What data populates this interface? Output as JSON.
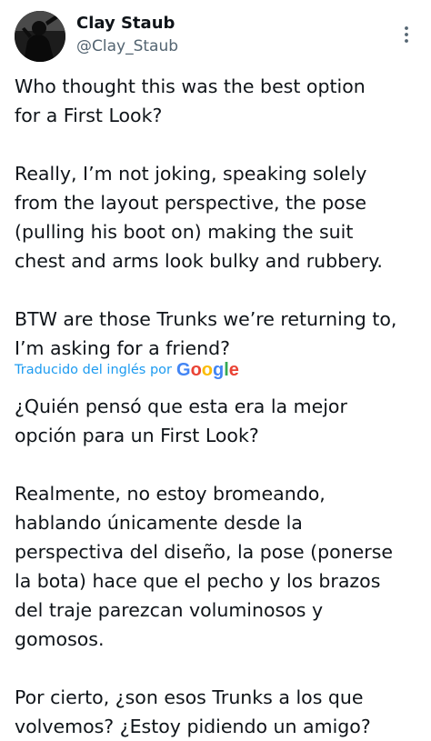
{
  "author": {
    "display_name": "Clay Staub",
    "handle": "@Clay_Staub",
    "avatar_icon": "profile-avatar"
  },
  "menu": {
    "icon": "more-vertical-icon"
  },
  "tweet": {
    "original_text": "Who thought this was the best option\nfor a First Look?\n\nReally, I’m not joking, speaking solely\nfrom the layout perspective, the pose\n(pulling his boot on) making the suit\nchest and arms look bulky and rubbery.\n\nBTW are those Trunks we’re returning to,\nI’m asking for a friend?",
    "translated_text": "¿Quién pensó que esta era la mejor\nopción para un First Look?\n\nRealmente, no estoy bromeando,\nhablando únicamente desde la\nperspectiva del diseño, la pose (ponerse\nla bota) hace que el pecho y los brazos\ndel traje parezcan voluminosos y\ngomosos.\n\nPor cierto, ¿son esos Trunks a los que\nvolvemos? ¿Estoy pidiendo un amigo?"
  },
  "translation": {
    "label": "Traducido del inglés por",
    "provider": "Google",
    "provider_letters": [
      "G",
      "o",
      "o",
      "g",
      "l",
      "e"
    ]
  },
  "colors": {
    "link": "#1d9bf0",
    "text": "#0f1419",
    "secondary": "#536471",
    "google_blue": "#4285f4",
    "google_red": "#ea4335",
    "google_yellow": "#fbbc05",
    "google_green": "#34a853"
  }
}
